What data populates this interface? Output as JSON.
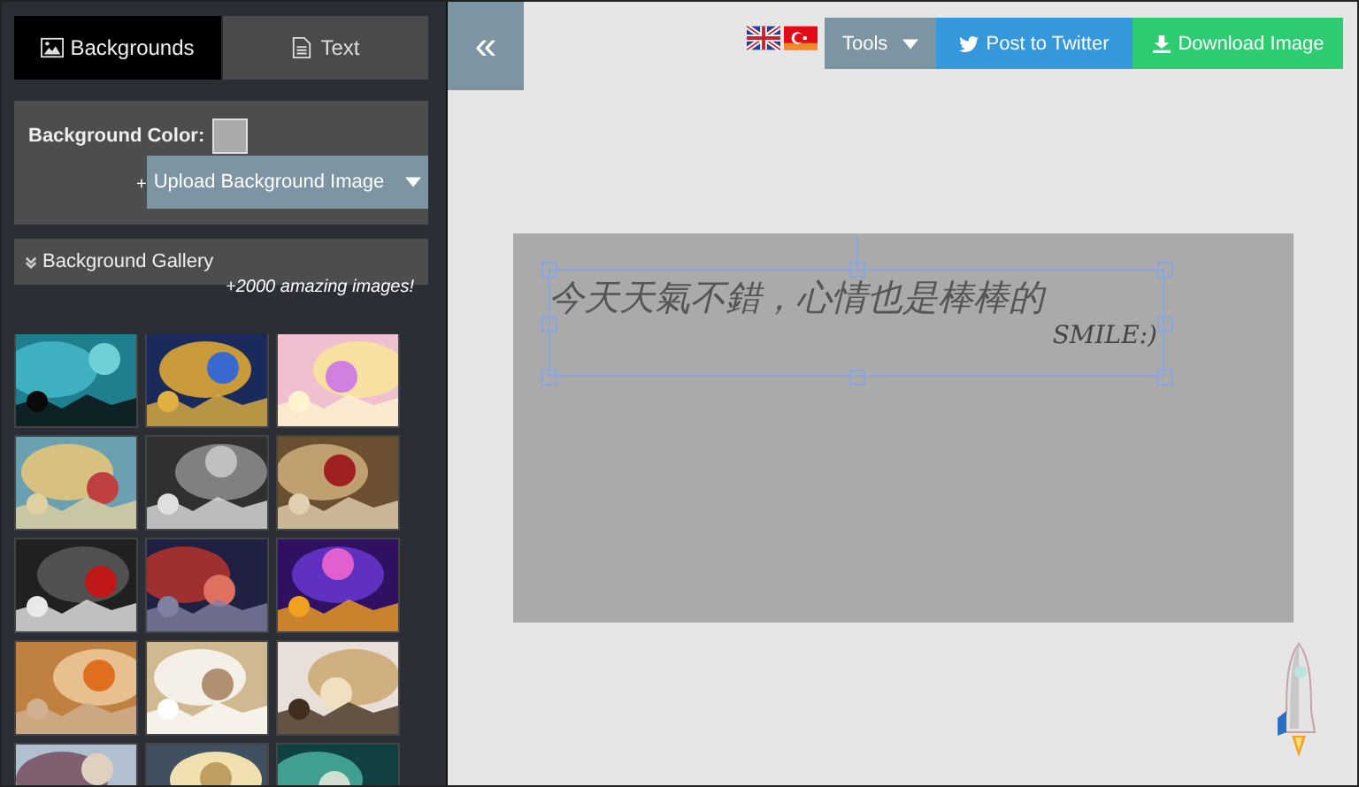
{
  "sidebar": {
    "tabs": [
      {
        "label": "Backgrounds",
        "selected": true
      },
      {
        "label": "Text",
        "selected": false
      }
    ],
    "background_color": {
      "label": "Background Color:",
      "color": "#aaaaaa"
    },
    "upload_prefix": "+",
    "upload_button": "Upload Background Image",
    "gallery": {
      "title": "Background Gallery",
      "note": "+2000 amazing images!",
      "expanded": true
    }
  },
  "toolbar": {
    "collapse": "«",
    "tools": "Tools",
    "twitter": "Post to Twitter",
    "download": "Download Image"
  },
  "canvas": {
    "text_box": {
      "selected": true,
      "lines": [
        "今天天氣不錯，心情也是棒棒的",
        "SMILE:)"
      ]
    }
  }
}
